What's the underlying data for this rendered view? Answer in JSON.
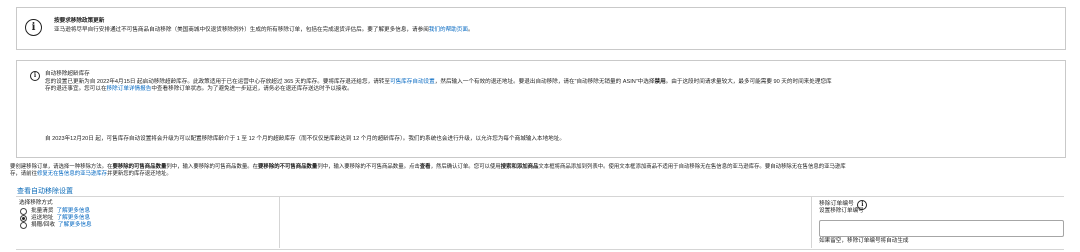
{
  "banner_update": {
    "title": "按要求移除政策更新",
    "body": "亚马逊将尽早自行安排通过不可售商品自动移除（美国商城中仅退货移除例外）生成的所有移除订单，包括在完成退货评估后。要了解更多信息，请参阅",
    "link": "我们的帮助页面",
    "tail": "。"
  },
  "banner_auto": {
    "title": "自动移除超龄库存",
    "line1a": "您的设置已更新为自 2022年4月15日 起启动移除超龄库存。此政策适用于已在运营中心存放超过 365 天的库存。要将库存退还给您，请转至",
    "line1_link": "可售库存自动设置",
    "line1b": "，然后输入一个有效的退还地址。要退出自动移除，请在“自动移除无销量的 ASIN”中选择",
    "line1_bold": "禁用",
    "line1c": "。由于这段时间请求量较大，最多可能需要 90 天的时间来处理您库",
    "line2a": "存的退还事宜。您可以在",
    "line2_link": "移除订单详情报告",
    "line2b": "中查看移除订单状态。为了避免进一步延迟，请务必在退还库存送达时予以接收。",
    "line3": "自 2023年12月20日 起，可售库存自动设置将会升级为可以配置移除库龄介于 1 至 12 个月的超龄库存（而不仅仅是库龄达到 12 个月的超龄库存）。我们的系统也会进行升级，以允许您为每个商城输入本地地址。"
  },
  "instructions": {
    "p1": "要创建移除订单，请选择一种移除方法。在",
    "p1_bold": "要移除的可售商品数量",
    "p2": "列中，输入要移除的可售商品数量。在",
    "p2_bold": "要移除的不可售商品数量",
    "p3": "列中，输入要移除的不可售商品数量。点击",
    "p3_bold": "查看",
    "p4": "，然后确认订单。您可以使用",
    "p4_bold": "搜索和添加商品",
    "p5": "文本框将商品添加到列表中。使用文本框添加商品不适用于自动移除无在售信息的亚马逊库存。要自动移除无在售信息的亚马逊库",
    "line2a": "存，请前往",
    "line2_link": "修复无在售信息的亚马逊库存",
    "line2b": "并更新您的库存退还地址。"
  },
  "view_auto_settings_link": "查看自动移除设置",
  "method": {
    "label": "选择移除方式",
    "options": [
      {
        "label": "批量清货",
        "link": "了解更多信息",
        "selected": false
      },
      {
        "label": "运送地址",
        "link": "了解更多信息",
        "selected": true
      },
      {
        "label": "捐赠/回收",
        "link": "了解更多信息",
        "selected": false
      }
    ]
  },
  "order_id": {
    "label": "移除订单编号",
    "sub_label": "设置移除订单编号",
    "value": "",
    "helper": "如果留空，移除订单编号将自动生成"
  },
  "icons": {
    "info": "info-icon"
  }
}
